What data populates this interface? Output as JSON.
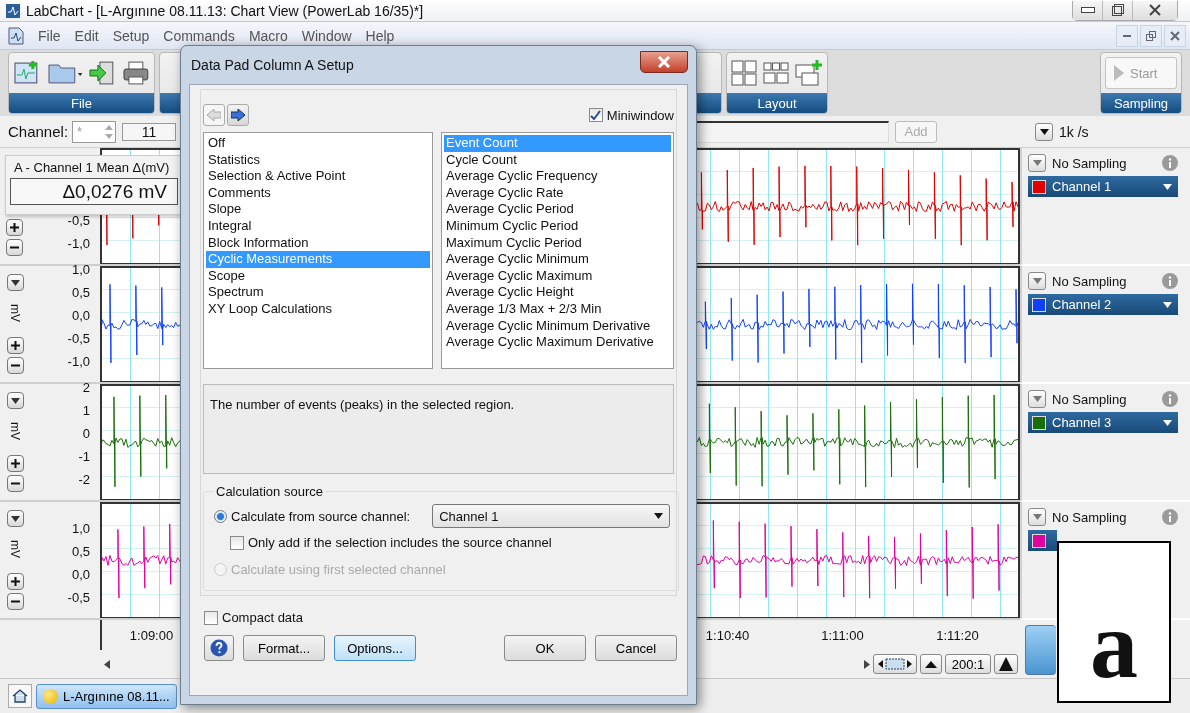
{
  "window": {
    "title": "LabChart - [L-Argınıne 08.11.13: Chart View (PowerLab 16/35)*]"
  },
  "menu": [
    "File",
    "Edit",
    "Setup",
    "Commands",
    "Macro",
    "Window",
    "Help"
  ],
  "ribbon": {
    "groups": [
      {
        "kind": "file",
        "label": "File"
      },
      {
        "kind": "tools"
      },
      {
        "kind": "layout",
        "label": "Layout"
      },
      {
        "kind": "spacer"
      },
      {
        "kind": "sampling",
        "label": "Sampling",
        "button": "Start"
      }
    ]
  },
  "channel_bar": {
    "label": "Channel:",
    "spin_value": "*",
    "number": "11",
    "add_button": "Add",
    "rate": "1k /s"
  },
  "data_pad": {
    "title": "A - Channel 1 Mean Δ(mV)",
    "value": "Δ0,0276 mV"
  },
  "channels": [
    {
      "color": "#e00000",
      "ticks": [
        "-0,5",
        "-1,0"
      ],
      "sampling": "No Sampling",
      "name": "Channel 1"
    },
    {
      "color": "#1040ff",
      "unit": "mV",
      "ticks": [
        "1,0",
        "0,5",
        "0,0",
        "-0,5",
        "-1,0"
      ],
      "sampling": "No Sampling",
      "name": "Channel 2"
    },
    {
      "color": "#1a6e0a",
      "unit": "mV",
      "ticks": [
        "2",
        "1",
        "0",
        "-1",
        "-2"
      ],
      "sampling": "No Sampling",
      "name": "Channel 3"
    },
    {
      "color": "#e000a0",
      "unit": "mV",
      "ticks": [
        "1,0",
        "0,5",
        "0,0",
        "-0,5"
      ],
      "sampling": "No Sampling"
    }
  ],
  "time_axis": [
    "1:09:00",
    "1:10:40",
    "1:11:00",
    "1:11:20"
  ],
  "scroll": {
    "ratio": "200:1"
  },
  "taskbar": {
    "tab": "L-Argınıne 08.11..."
  },
  "dialog": {
    "title": "Data Pad Column A Setup",
    "miniwindow": {
      "label": "Miniwindow",
      "checked": true
    },
    "categories": [
      {
        "label": "Off",
        "selected": false
      },
      {
        "label": "Statistics",
        "selected": false
      },
      {
        "label": "Selection & Active Point",
        "selected": false
      },
      {
        "label": "Comments",
        "selected": false
      },
      {
        "label": "Slope",
        "selected": false
      },
      {
        "label": "Integral",
        "selected": false
      },
      {
        "label": "Block Information",
        "selected": false
      },
      {
        "label": "Cyclic Measurements",
        "selected": true
      },
      {
        "label": "Scope",
        "selected": false
      },
      {
        "label": "Spectrum",
        "selected": false
      },
      {
        "label": "XY Loop Calculations",
        "selected": false
      }
    ],
    "functions": [
      {
        "label": "Event Count",
        "selected": true
      },
      {
        "label": "Cycle Count",
        "selected": false
      },
      {
        "label": "Average Cyclic Frequency",
        "selected": false
      },
      {
        "label": "Average Cyclic Rate",
        "selected": false
      },
      {
        "label": "Average Cyclic Period",
        "selected": false
      },
      {
        "label": "Minimum Cyclic Period",
        "selected": false
      },
      {
        "label": "Maximum Cyclic Period",
        "selected": false
      },
      {
        "label": "Average Cyclic Minimum",
        "selected": false
      },
      {
        "label": "Average Cyclic Maximum",
        "selected": false
      },
      {
        "label": "Average Cyclic Height",
        "selected": false
      },
      {
        "label": "Average 1/3 Max + 2/3 Min",
        "selected": false
      },
      {
        "label": "Average Cyclic Minimum Derivative",
        "selected": false
      },
      {
        "label": "Average Cyclic Maximum Derivative",
        "selected": false
      }
    ],
    "description": "The number of events (peaks) in the selected region.",
    "source": {
      "title": "Calculation source",
      "options": [
        {
          "label": "Calculate from source channel:",
          "selected": true,
          "disabled": false
        },
        {
          "label": "Calculate using first selected channel",
          "selected": false,
          "disabled": true
        }
      ],
      "channel": "Channel 1",
      "only_add": {
        "label": "Only add if the selection includes the source channel",
        "checked": false
      }
    },
    "compact": {
      "label": "Compact data",
      "checked": false
    },
    "left_buttons": [
      {
        "label": "Format...",
        "focused": false
      },
      {
        "label": "Options...",
        "focused": true
      }
    ],
    "right_buttons": [
      {
        "label": "OK",
        "focused": false
      },
      {
        "label": "Cancel",
        "focused": false
      }
    ]
  },
  "panel_label": "a"
}
